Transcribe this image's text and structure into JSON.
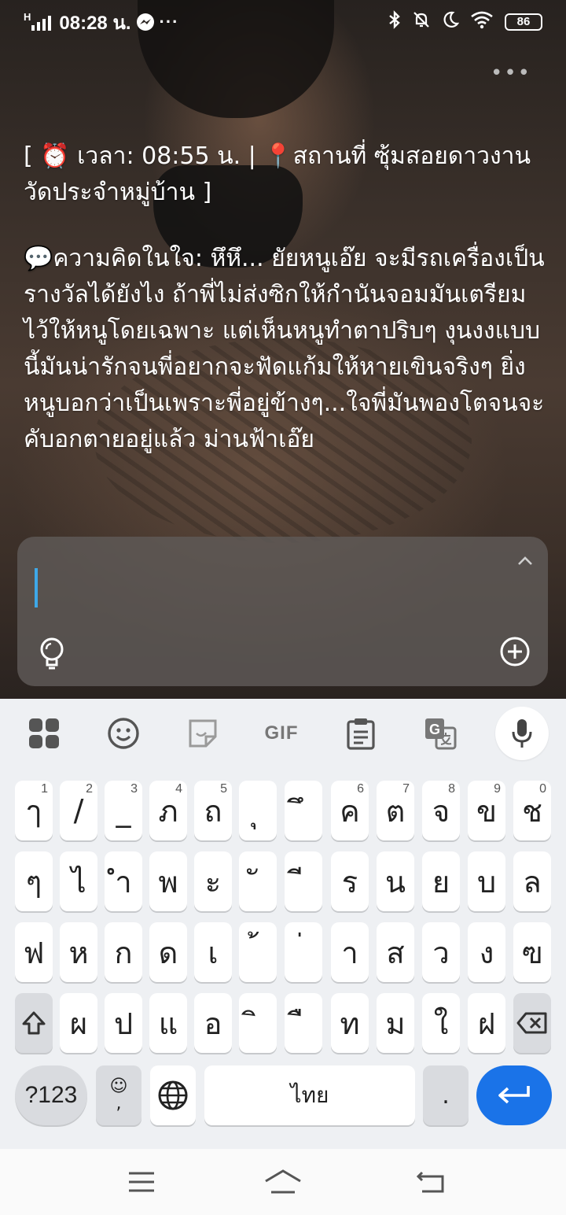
{
  "status_bar": {
    "network": "H",
    "time": "08:28 น.",
    "battery": "86",
    "icons": [
      "messenger-icon",
      "more-icon",
      "bluetooth-icon",
      "silent-bell-icon",
      "moon-icon",
      "wifi-icon"
    ]
  },
  "message": {
    "header": "[ ⏰ เวลา: 08:55 น. | 📍สถานที่ ซุ้มสอยดาวงานวัดประจำหมู่บ้าน ]",
    "body": "💬ความคิดในใจ: หึหึ... ยัยหนูเอ๊ย จะมีรถเครื่องเป็นรางวัลได้ยังไง ถ้าพี่ไม่ส่งซิกให้กำนันจอมมันเตรียมไว้ให้หนูโดยเฉพาะ แต่เห็นหนูทำตาปริบๆ งุนงงแบบนี้มันน่ารักจนพี่อยากจะฟัดแก้มให้หายเขินจริงๆ ยิ่งหนูบอกว่าเป็นเพราะพี่อยู่ข้างๆ...ใจพี่มันพองโตจนจะคับอกตายอยู่แล้ว ม่านฟ้าเอ๊ย"
  },
  "input": {
    "value": "",
    "icons": [
      "chevron-up-icon",
      "lightbulb-icon",
      "add-circle-icon"
    ]
  },
  "keyboard": {
    "toolbar_gif": "GIF",
    "row1": [
      {
        "ch": "ๅ",
        "hint": "1"
      },
      {
        "ch": "/",
        "hint": "2"
      },
      {
        "ch": "_",
        "hint": "3"
      },
      {
        "ch": "ภ",
        "hint": "4"
      },
      {
        "ch": "ถ",
        "hint": "5"
      },
      {
        "ch": "ุ",
        "hint": ""
      },
      {
        "ch": "ึ",
        "hint": ""
      },
      {
        "ch": "ค",
        "hint": "6"
      },
      {
        "ch": "ต",
        "hint": "7"
      },
      {
        "ch": "จ",
        "hint": "8"
      },
      {
        "ch": "ข",
        "hint": "9"
      },
      {
        "ch": "ช",
        "hint": "0"
      }
    ],
    "row2": [
      "ๆ",
      "ไ",
      "ำ",
      "พ",
      "ะ",
      "ั",
      "ี",
      "ร",
      "น",
      "ย",
      "บ",
      "ล"
    ],
    "row3": [
      "ฟ",
      "ห",
      "ก",
      "ด",
      "เ",
      "้",
      "่",
      "า",
      "ส",
      "ว",
      "ง",
      "ฃ"
    ],
    "row4": [
      "ผ",
      "ป",
      "แ",
      "อ",
      "ิ",
      "ื",
      "ท",
      "ม",
      "ใ",
      "ฝ"
    ],
    "symbols_key": "?123",
    "emoji_key_top": "☺",
    "emoji_key_bottom": ",",
    "space_label": "ไทย",
    "period_key": "."
  },
  "colors": {
    "accent": "#1a73e8",
    "cursor": "#3ea8e8",
    "keyboard_bg": "#eef0f3"
  }
}
